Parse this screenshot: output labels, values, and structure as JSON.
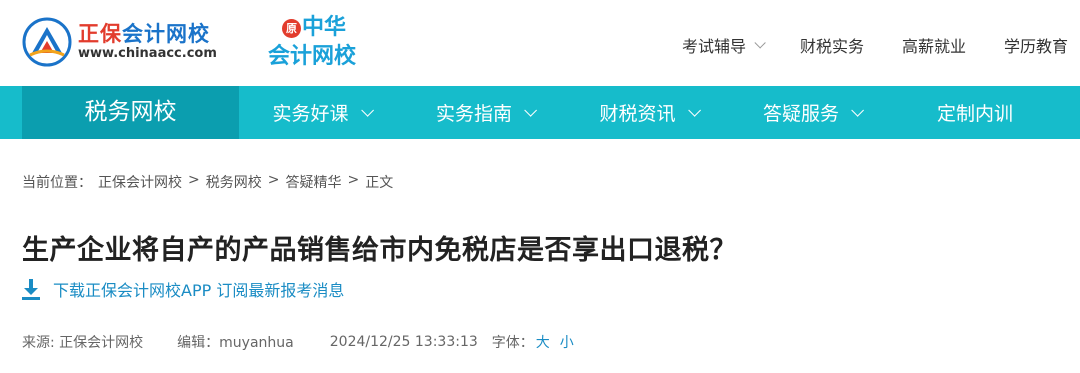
{
  "header": {
    "logo1": {
      "brand_red": "正保",
      "brand_blue": "会计网校",
      "url": "www.chinaacc.com"
    },
    "logo2": {
      "badge": "原",
      "line1": "中华",
      "line2": "会计网校"
    },
    "topnav": [
      {
        "label": "考试辅导",
        "has_dropdown": true
      },
      {
        "label": "财税实务",
        "has_dropdown": false
      },
      {
        "label": "高薪就业",
        "has_dropdown": false
      },
      {
        "label": "学历教育",
        "has_dropdown": false
      }
    ]
  },
  "navbar": {
    "home": "税务网校",
    "items": [
      {
        "label": "实务好课",
        "has_dropdown": true
      },
      {
        "label": "实务指南",
        "has_dropdown": true
      },
      {
        "label": "财税资讯",
        "has_dropdown": true
      },
      {
        "label": "答疑服务",
        "has_dropdown": true
      },
      {
        "label": "定制内训",
        "has_dropdown": false
      }
    ]
  },
  "breadcrumb": {
    "prefix": "当前位置：",
    "items": [
      "正保会计网校",
      "税务网校",
      "答疑精华",
      "正文"
    ],
    "separator": ">"
  },
  "article": {
    "title": "生产企业将自产的产品销售给市内免税店是否享出口退税？",
    "download_text": "下载正保会计网校APP 订阅最新报考消息",
    "source": "来源: 正保会计网校",
    "editor": "编辑：muyanhua",
    "datetime": "2024/12/25 13:33:13",
    "font_label": "字体：",
    "font_large": "大",
    "font_small": "小"
  },
  "colors": {
    "nav_bg": "#16bccb",
    "nav_home_bg": "#0b9eaf",
    "link_blue": "#1a8cc4",
    "brand_red": "#e23c2d",
    "brand_blue": "#1a73c9"
  }
}
